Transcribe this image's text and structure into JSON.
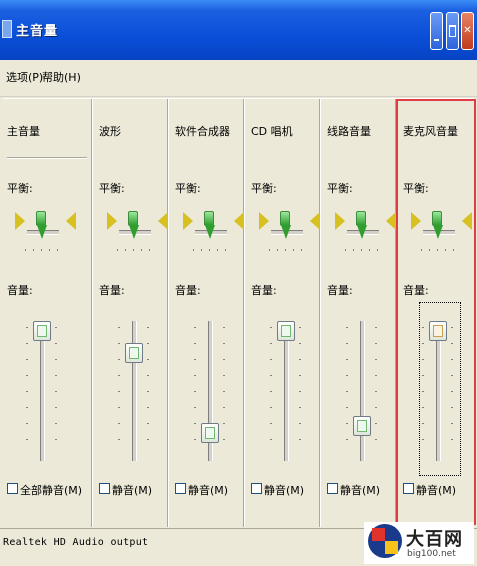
{
  "window": {
    "title": "主音量",
    "buttons": {
      "minimize": "minimize",
      "maximize": "maximize",
      "close": "close"
    }
  },
  "menu": {
    "options": "选项(P)",
    "help": "帮助(H)"
  },
  "columns": [
    {
      "name": "主音量",
      "balance_label": "平衡:",
      "volume_label": "音量:",
      "volume_level": 0.95,
      "mute_label": "全部静音(M)",
      "muted": false
    },
    {
      "name": "波形",
      "balance_label": "平衡:",
      "volume_label": "音量:",
      "volume_level": 0.78,
      "mute_label": "静音(M)",
      "muted": false
    },
    {
      "name": "软件合成器",
      "balance_label": "平衡:",
      "volume_label": "音量:",
      "volume_level": 0.14,
      "mute_label": "静音(M)",
      "muted": false
    },
    {
      "name": "CD 唱机",
      "balance_label": "平衡:",
      "volume_label": "音量:",
      "volume_level": 0.95,
      "mute_label": "静音(M)",
      "muted": false
    },
    {
      "name": "线路音量",
      "balance_label": "平衡:",
      "volume_label": "音量:",
      "volume_level": 0.2,
      "mute_label": "静音(M)",
      "muted": false
    },
    {
      "name": "麦克风音量",
      "balance_label": "平衡:",
      "volume_label": "音量:",
      "volume_level": 0.95,
      "mute_label": "静音(M)",
      "muted": false
    }
  ],
  "status": "Realtek HD Audio output",
  "watermark": {
    "name": "大百网",
    "url": "big100.net"
  },
  "colors": {
    "titlebar": "#0a4fd8",
    "highlight": "#e03c46",
    "face": "#ece9d8",
    "balance_thumb": "#2f9e2f",
    "speaker_arrow": "#d8c020"
  }
}
